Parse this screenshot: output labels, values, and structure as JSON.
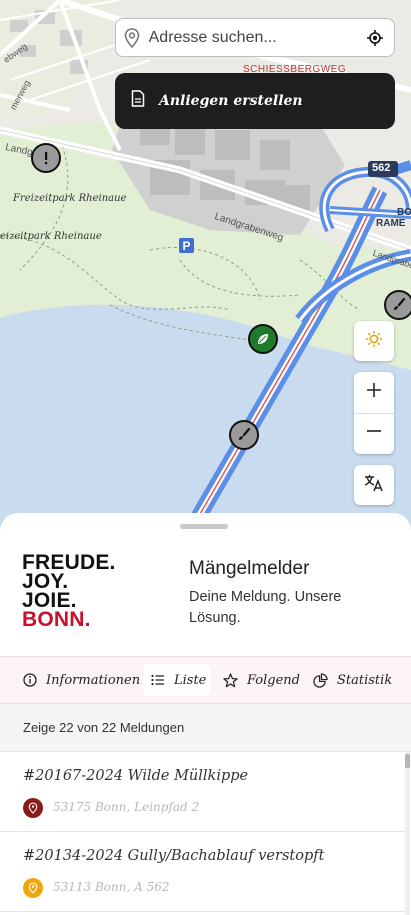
{
  "search": {
    "placeholder": "Adresse suchen..."
  },
  "create_issue": {
    "label": "Anliegen erstellen"
  },
  "map": {
    "labels": {
      "schiessbergweg": "SCHIESSBERGWEG",
      "park_top": "Freizeitpark Rheinaue",
      "park_left": "eizeitpark Rheinaue",
      "landgrabenweg": "Landgrabenweg",
      "landgrabenweg_short": "Landgr",
      "route_shield": "562",
      "bonn_top": "BO",
      "bonn_bottom": "RAME",
      "road_right": "ß",
      "hiddle_left": "merweg",
      "top_left": "ebweg",
      "parking": "P",
      "landgr_right": "Landgraben"
    }
  },
  "controls": {
    "theme": "theme-toggle",
    "zoom_in": "+",
    "zoom_out": "−",
    "translate": "translate"
  },
  "brand": {
    "line1": "FREUDE.",
    "line2": "JOY.",
    "line3": "JOIE.",
    "line4": "BONN."
  },
  "app": {
    "title": "Mängelmelder",
    "subtitle": "Deine Meldung. Unsere Lösung."
  },
  "tabs": [
    {
      "label": "Informationen",
      "icon": "info-icon",
      "active": false
    },
    {
      "label": "Liste",
      "icon": "list-icon",
      "active": true
    },
    {
      "label": "Folgend",
      "icon": "star-icon",
      "active": false
    },
    {
      "label": "Statistik",
      "icon": "pie-chart-icon",
      "active": false
    }
  ],
  "list": {
    "count_text": "Zeige 22 von 22 Meldungen",
    "items": [
      {
        "title": "#20167-2024 Wilde Müllkippe",
        "location": "53175 Bonn, Leinpfad 2",
        "status_color": "#8b1a1a"
      },
      {
        "title": "#20134-2024 Gully/Bachablauf verstopft",
        "location": "53113 Bonn, A 562",
        "status_color": "#f2a50c"
      }
    ]
  },
  "colors": {
    "brand_red": "#c8102e",
    "water": "#c9dcef",
    "park": "#e2efd4",
    "highway": "#5b8ee6"
  }
}
